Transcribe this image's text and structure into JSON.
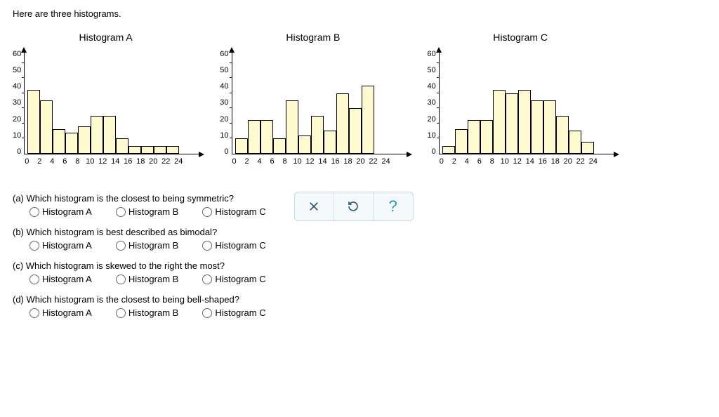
{
  "intro": "Here are three histograms.",
  "chart_data": [
    {
      "type": "bar",
      "title": "Histogram A",
      "values": [
        42,
        35,
        16,
        14,
        18,
        25,
        25,
        10,
        5,
        5,
        5,
        5
      ],
      "ylim": [
        0,
        65
      ],
      "y_ticks": [
        60,
        50,
        40,
        30,
        20,
        10,
        0
      ],
      "x_ticks": [
        0,
        2,
        4,
        6,
        8,
        10,
        12,
        14,
        16,
        18,
        20,
        22,
        24
      ]
    },
    {
      "type": "bar",
      "title": "Histogram B",
      "values": [
        10,
        22,
        22,
        10,
        35,
        12,
        25,
        15,
        40,
        30,
        45,
        0
      ],
      "ylim": [
        0,
        65
      ],
      "y_ticks": [
        60,
        50,
        40,
        30,
        20,
        10,
        0
      ],
      "x_ticks": [
        0,
        2,
        4,
        6,
        8,
        10,
        12,
        14,
        16,
        18,
        20,
        22,
        24
      ]
    },
    {
      "type": "bar",
      "title": "Histogram C",
      "values": [
        5,
        16,
        22,
        22,
        42,
        40,
        42,
        35,
        35,
        25,
        15,
        8
      ],
      "ylim": [
        0,
        65
      ],
      "y_ticks": [
        60,
        50,
        40,
        30,
        20,
        10,
        0
      ],
      "x_ticks": [
        0,
        2,
        4,
        6,
        8,
        10,
        12,
        14,
        16,
        18,
        20,
        22,
        24
      ]
    }
  ],
  "questions": [
    {
      "id": "a",
      "text": "(a) Which histogram is the closest to being symmetric?",
      "options": [
        "Histogram A",
        "Histogram B",
        "Histogram C"
      ]
    },
    {
      "id": "b",
      "text": "(b) Which histogram is best described as bimodal?",
      "options": [
        "Histogram A",
        "Histogram B",
        "Histogram C"
      ]
    },
    {
      "id": "c",
      "text": "(c) Which histogram is skewed to the right the most?",
      "options": [
        "Histogram A",
        "Histogram B",
        "Histogram C"
      ]
    },
    {
      "id": "d",
      "text": "(d) Which histogram is the closest to being bell-shaped?",
      "options": [
        "Histogram A",
        "Histogram B",
        "Histogram C"
      ]
    }
  ],
  "toolbar": {
    "close": "×",
    "reset": "↺",
    "help": "?"
  }
}
